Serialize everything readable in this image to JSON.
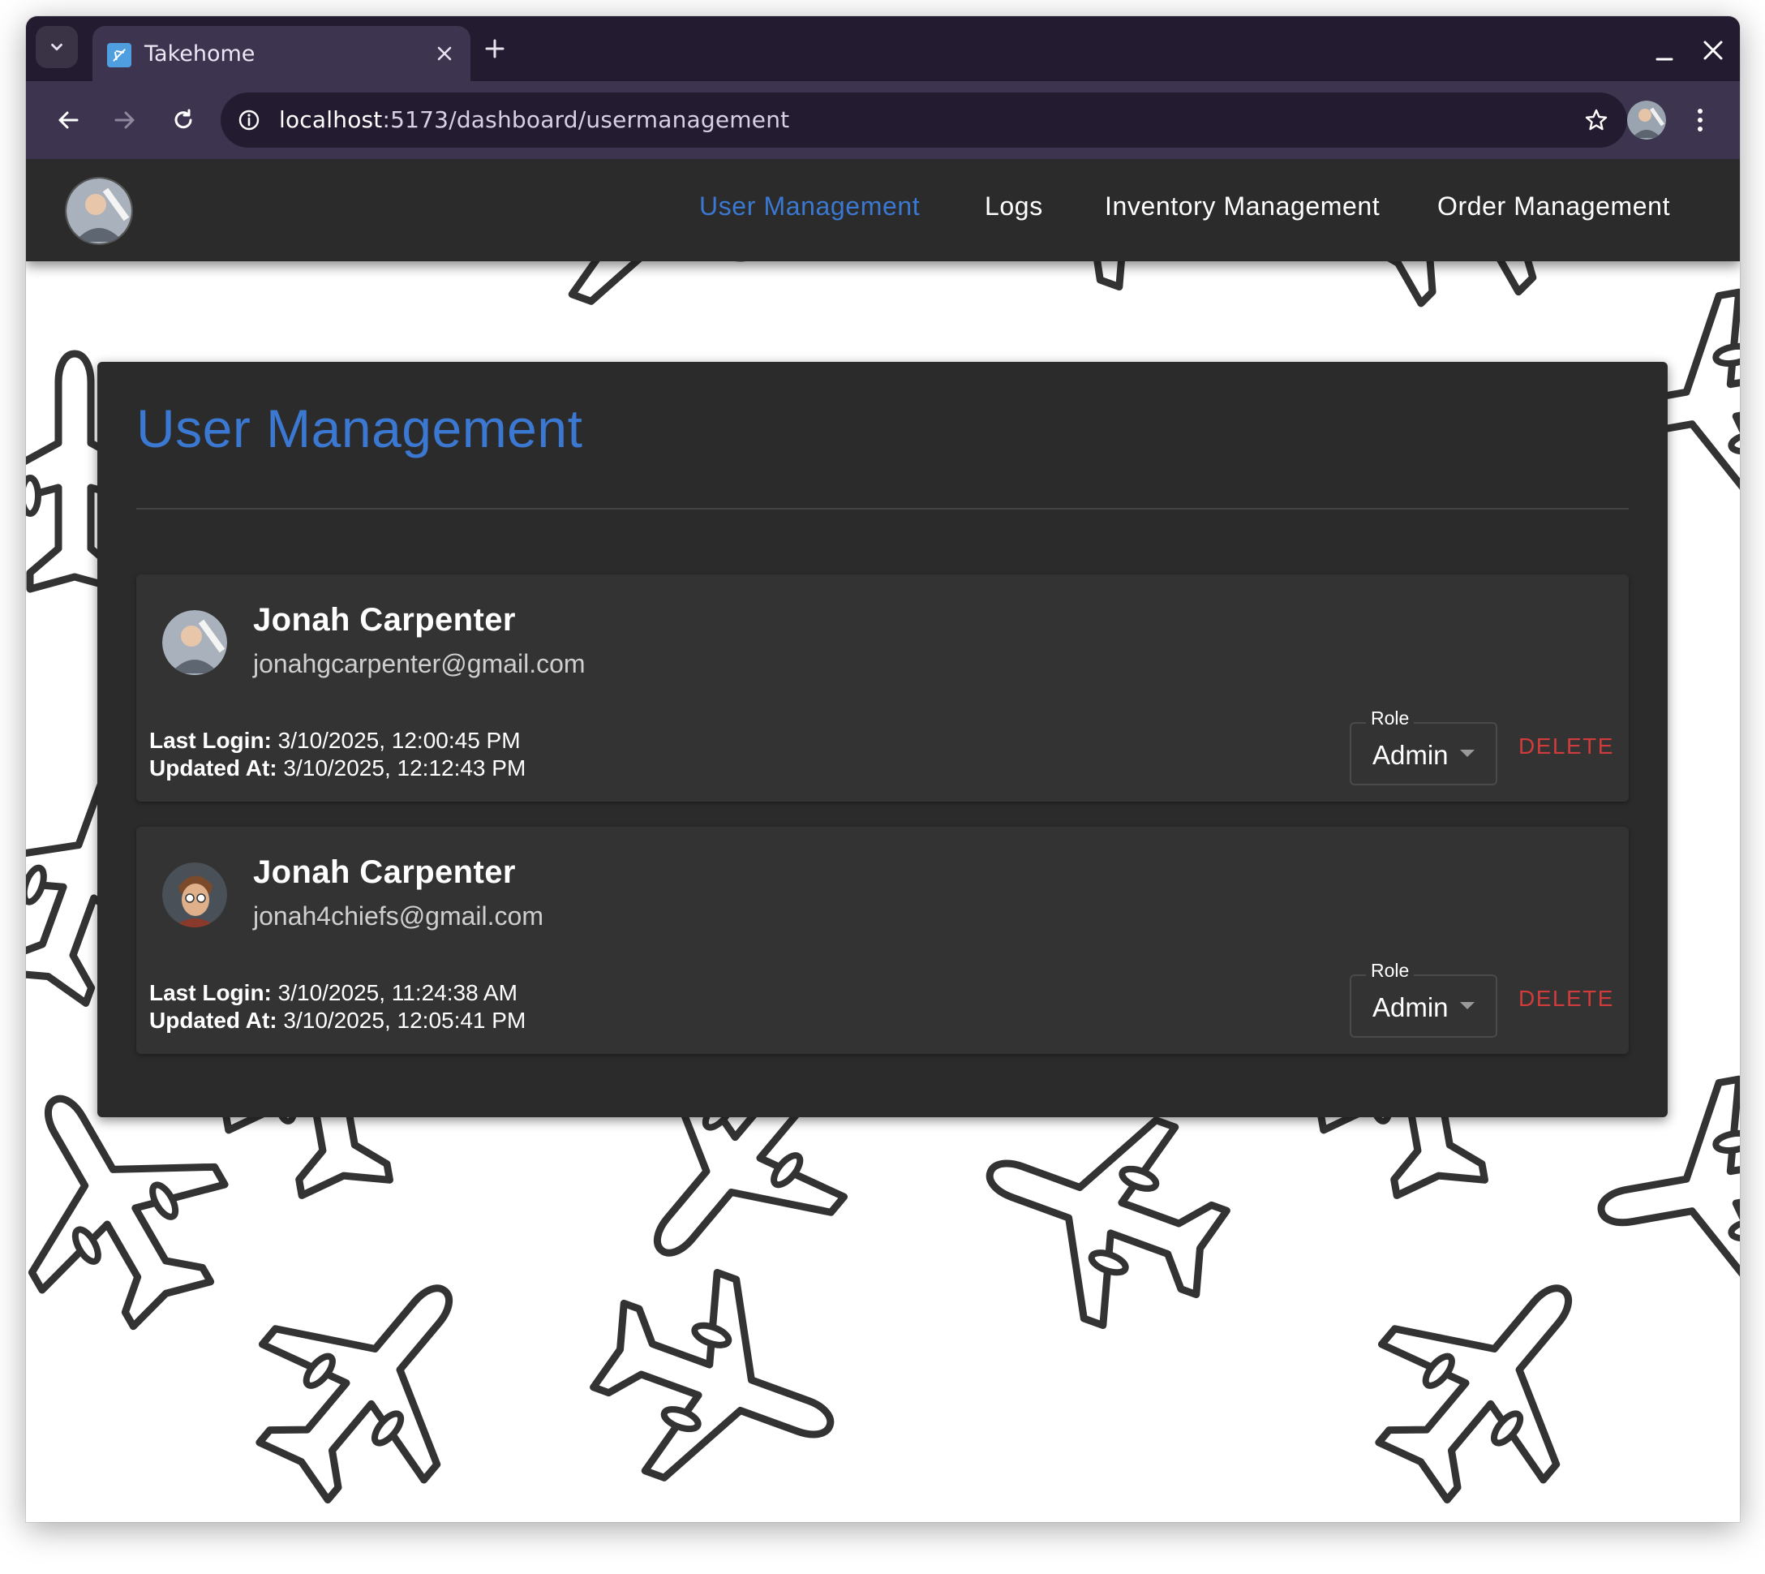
{
  "browser": {
    "tab_title": "Takehome",
    "url_host": "localhost",
    "url_rest": ":5173/dashboard/usermanagement"
  },
  "navbar": {
    "links": [
      {
        "label": "User Management",
        "active": true
      },
      {
        "label": "Logs",
        "active": false
      },
      {
        "label": "Inventory Management",
        "active": false
      },
      {
        "label": "Order Management",
        "active": false
      }
    ]
  },
  "main": {
    "title": "User Management",
    "users": [
      {
        "name": "Jonah Carpenter",
        "email": "jonahgcarpenter@gmail.com",
        "last_login_label": "Last Login:",
        "last_login": "3/10/2025, 12:00:45 PM",
        "updated_at_label": "Updated At:",
        "updated_at": "3/10/2025, 12:12:43 PM",
        "role_label": "Role",
        "role": "Admin",
        "delete_label": "DELETE"
      },
      {
        "name": "Jonah Carpenter",
        "email": "jonah4chiefs@gmail.com",
        "last_login_label": "Last Login:",
        "last_login": "3/10/2025, 11:24:38 AM",
        "updated_at_label": "Updated At:",
        "updated_at": "3/10/2025, 12:05:41 PM",
        "role_label": "Role",
        "role": "Admin",
        "delete_label": "DELETE"
      }
    ]
  },
  "colors": {
    "accent": "#3b78d1",
    "danger": "#d03c3c",
    "surface": "#2b2b2b",
    "card": "#333333",
    "browser_frame": "#231c30"
  },
  "icons": [
    "tab-list-icon",
    "airplane-favicon",
    "close-icon",
    "plus-icon",
    "minimize-icon",
    "back-arrow-icon",
    "forward-arrow-icon",
    "reload-icon",
    "info-icon",
    "star-icon",
    "kebab-menu-icon",
    "airplane-pattern"
  ]
}
